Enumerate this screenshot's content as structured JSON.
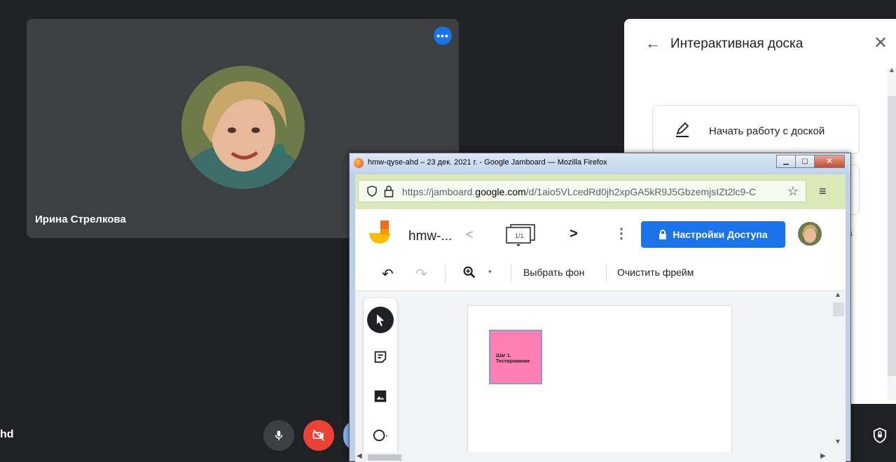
{
  "meet": {
    "participant_name": "Ирина Стрелкова",
    "meeting_code_fragment": "hd",
    "more_options_glyph": "•••",
    "controls": [
      {
        "name": "mic-button",
        "icon": "mic-icon"
      },
      {
        "name": "camera-off-button",
        "icon": "camera-off-icon"
      }
    ]
  },
  "panel": {
    "back_glyph": "←",
    "title": "Интерактивная доска",
    "close_glyph": "✕",
    "start_button_label": "Начать работу с доской",
    "label_fragment": "а"
  },
  "firefox": {
    "window_title": "hmw-qyse-ahd – 23 дек. 2021 г. - Google Jamboard — Mozilla Firefox",
    "url_prefix": "https://jamboard.",
    "url_domain": "google.com",
    "url_suffix": "/d/1aio5VLcedRd0jh2xpGA5kR9J5GbzemjsIZt2lc9-C",
    "menu_glyph": "≡",
    "star_glyph": "☆"
  },
  "jamboard": {
    "doc_title": "hmw-...",
    "prev_glyph": "<",
    "next_glyph": ">",
    "frame_indicator": "1/1",
    "kebab_glyph": "⋮",
    "share_label": "Настройки Доступа",
    "undo_glyph": "↶",
    "redo_glyph": "↷",
    "zoom_caret": "▾",
    "set_background_label": "Выбрать фон",
    "clear_frame_label": "Очистить фрейм",
    "sticky_note_text": "Шаг 1.\nТестирование",
    "colors": {
      "share_button": "#1a73e8",
      "sticky_note": "#ff7eb3",
      "meet_end_red": "#ea4335"
    }
  }
}
